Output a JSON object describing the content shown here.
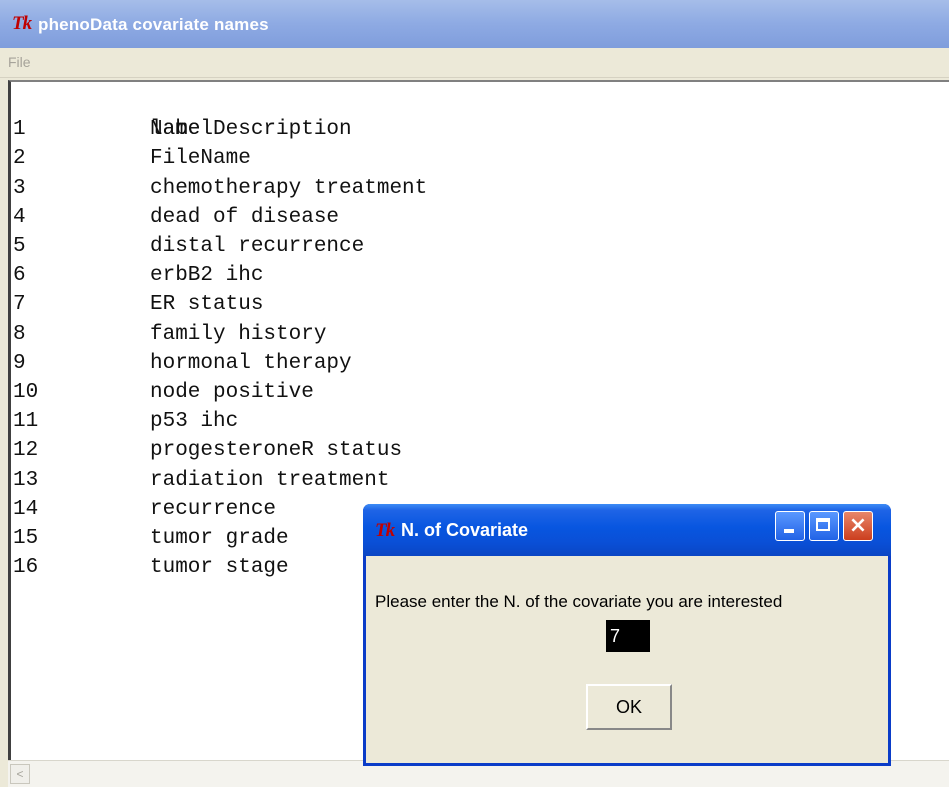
{
  "main_window": {
    "icon": "tk",
    "title": "phenoData covariate names",
    "menu": {
      "file": "File"
    }
  },
  "text_content": {
    "header": "labelDescription",
    "rows": [
      {
        "num": "1",
        "label": "Name"
      },
      {
        "num": "2",
        "label": "FileName"
      },
      {
        "num": "3",
        "label": "chemotherapy treatment"
      },
      {
        "num": "4",
        "label": "dead of disease"
      },
      {
        "num": "5",
        "label": "distal recurrence"
      },
      {
        "num": "6",
        "label": "erbB2 ihc"
      },
      {
        "num": "7",
        "label": "ER status"
      },
      {
        "num": "8",
        "label": "family history"
      },
      {
        "num": "9",
        "label": "hormonal therapy"
      },
      {
        "num": "10",
        "label": "node positive"
      },
      {
        "num": "11",
        "label": "p53 ihc"
      },
      {
        "num": "12",
        "label": "progesteroneR status"
      },
      {
        "num": "13",
        "label": "radiation treatment"
      },
      {
        "num": "14",
        "label": "recurrence"
      },
      {
        "num": "15",
        "label": "tumor grade"
      },
      {
        "num": "16",
        "label": "tumor stage"
      }
    ]
  },
  "dialog": {
    "icon": "tk",
    "title": "N. of Covariate",
    "message": "Please enter the N. of the covariate you are interested",
    "input_value": "7",
    "ok_label": "OK"
  },
  "icons": {
    "app_icon": "Tk",
    "minimize": "minimize-icon",
    "maximize": "maximize-icon",
    "close": "×",
    "scroll_left": "<"
  },
  "colors": {
    "main_titlebar": "#8eaae3",
    "dialog_titlebar": "#0856e0",
    "window_bg": "#ece9d8",
    "tk_icon": "#c00000"
  }
}
